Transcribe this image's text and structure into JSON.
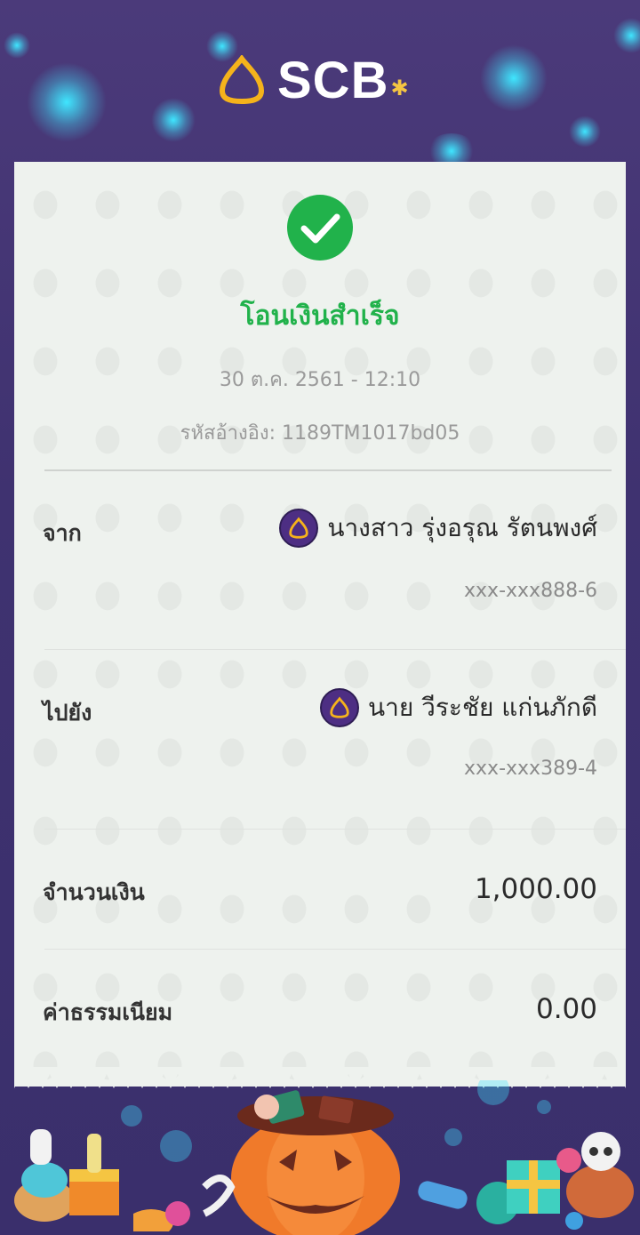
{
  "brand": {
    "name": "SCB"
  },
  "receipt": {
    "status_title": "โอนเงินสำเร็จ",
    "datetime": "30 ต.ค. 2561 - 12:10",
    "reference_label": "รหัสอ้างอิง:",
    "reference_value": "1189TM1017bd05"
  },
  "from": {
    "label": "จาก",
    "name": "นางสาว รุ่งอรุณ รัตนพงศ์",
    "account": "xxx-xxx888-6"
  },
  "to": {
    "label": "ไปยัง",
    "name": "นาย วีระชัย แก่นภักดี",
    "account": "xxx-xxx389-4"
  },
  "amount": {
    "label": "จำนวนเงิน",
    "value": "1,000.00"
  },
  "fee": {
    "label": "ค่าธรรมเนียม",
    "value": "0.00"
  },
  "colors": {
    "success": "#21b24b",
    "background": "#3f3270",
    "brand_purple": "#4d2e83",
    "brand_gold": "#f5b31b"
  },
  "icons": {
    "status": "check-circle-icon",
    "bank": "scb-bank-icon"
  }
}
